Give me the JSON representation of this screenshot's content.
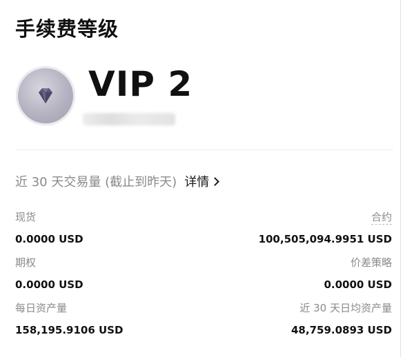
{
  "header": {
    "title": "手续费等级"
  },
  "vip": {
    "level": "VIP 2",
    "badge_icon": "diamond-icon",
    "colors": {
      "badge": "#b3b0bf",
      "diamond": "#5d5778"
    }
  },
  "volume": {
    "label": "近 30 天交易量 (截止到昨天)",
    "details_link": "详情"
  },
  "stats": {
    "spot": {
      "label": "现货",
      "value": "0.0000 USD"
    },
    "contract": {
      "label": "合约",
      "value": "100,505,094.9951 USD"
    },
    "options": {
      "label": "期权",
      "value": "0.0000 USD"
    },
    "spread": {
      "label": "价差策略",
      "value": "0.0000 USD"
    },
    "daily_assets": {
      "label": "每日资产量",
      "value": "158,195.9106 USD"
    },
    "avg_assets_30d": {
      "label": "近 30 天日均资产量",
      "value": "48,759.0893 USD"
    }
  }
}
